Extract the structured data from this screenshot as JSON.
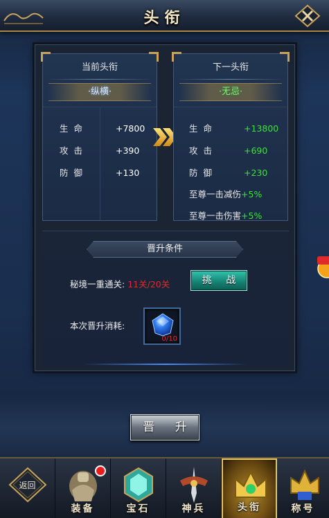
{
  "header": {
    "title": "头衔"
  },
  "current": {
    "header": "当前头衔",
    "rank": "·纵横·",
    "stats": [
      {
        "label": "生 命",
        "value": "+7800"
      },
      {
        "label": "攻 击",
        "value": "+390"
      },
      {
        "label": "防 御",
        "value": "+130"
      }
    ]
  },
  "next": {
    "header": "下一头衔",
    "rank": "·无忌·",
    "stats": [
      {
        "label": "生 命",
        "value": "+13800"
      },
      {
        "label": "攻 击",
        "value": "+690"
      },
      {
        "label": "防 御",
        "value": "+230"
      }
    ],
    "extra": [
      {
        "label": "至尊一击减伤",
        "value": "+5%"
      },
      {
        "label": "至尊一击伤害",
        "value": "+5%"
      }
    ]
  },
  "conditions": {
    "title": "晋升条件",
    "dungeon_label": "秘境一重通关:",
    "dungeon_progress": "11关/20关",
    "challenge_label": "挑 战",
    "cost_label": "本次晋升消耗:",
    "cost_item": "gem-icon",
    "cost_count": "0/10"
  },
  "promote": {
    "label": "晋 升"
  },
  "nav": {
    "back_label": "返回",
    "items": [
      {
        "label": "装备",
        "icon": "equipment-icon",
        "badge": true
      },
      {
        "label": "宝石",
        "icon": "gem-icon",
        "badge": false
      },
      {
        "label": "神兵",
        "icon": "weapon-icon",
        "badge": false
      },
      {
        "label": "头衔",
        "icon": "title-icon",
        "badge": false,
        "active": true
      },
      {
        "label": "称号",
        "icon": "honor-icon",
        "badge": false
      }
    ]
  },
  "colors": {
    "accent_gold": "#c9a45a",
    "green_value": "#3fe03f",
    "red_progress": "#e02a2a",
    "challenge_teal": "#168676"
  }
}
